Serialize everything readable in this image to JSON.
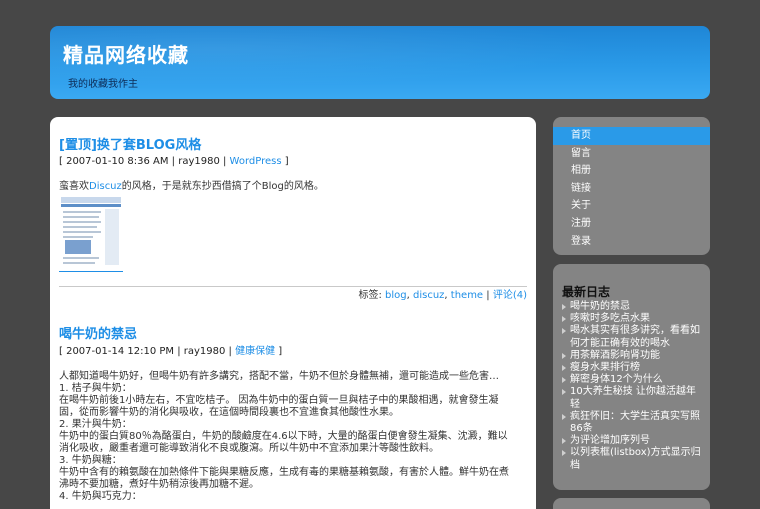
{
  "header": {
    "title": "精品网络收藏",
    "tagline": "我的收藏我作主"
  },
  "posts": [
    {
      "title": "[置顶]换了套BLOG风格",
      "meta_prefix": "[ 2007-01-10 8:36 AM | ray1980 | ",
      "meta_link": "WordPress",
      "meta_suffix": " ]",
      "body_prefix": "蛮喜欢",
      "body_link": "Discuz",
      "body_suffix": "的风格，于是就东抄西借搞了个Blog的风格。",
      "tags_label": "标签:",
      "tags": [
        "blog",
        "discuz",
        "theme"
      ],
      "comments": "评论(4)"
    },
    {
      "title": "喝牛奶的禁忌",
      "meta_prefix": "[ 2007-01-14 12:10 PM | ray1980 | ",
      "meta_link": "健康保健",
      "meta_suffix": " ]",
      "body_lines": [
        "人都知道喝牛奶好，但喝牛奶有許多講究，搭配不當，牛奶不但於身體無補，還可能造成一些危害…",
        "1. 桔子與牛奶：",
        "在喝牛奶前後1小時左右，不宜吃桔子。 因為牛奶中的蛋白質一旦與桔子中的果酸相遇，就會發生凝",
        "固，從而影響牛奶的消化與吸收，在這個時間段裏也不宜進食其他酸性水果。",
        "2. 果汁與牛奶：",
        "牛奶中的蛋白質80％為酪蛋白，牛奶的酸鹼度在4.6以下時，大量的酪蛋白便會發生凝集、沈澱，難以",
        "消化吸收，嚴重者還可能導致消化不良或腹瀉。所以牛奶中不宜添加果汁等酸性飲料。",
        "3. 牛奶與糖：",
        "牛奶中含有的賴氨酸在加熱條件下能與果糖反應，生成有毒的果糖基賴氨酸，有害於人體。鮮牛奶在煮",
        "沸時不要加糖，煮好牛奶稍涼後再加糖不遲。",
        "4. 牛奶與巧克力："
      ]
    }
  ],
  "nav": {
    "items": [
      "首页",
      "留言",
      "相册",
      "链接",
      "关于",
      "注册",
      "登录"
    ],
    "active_index": 0
  },
  "recent": {
    "heading": "最新日志",
    "items": [
      "喝牛奶的禁忌",
      "咳嗽时多吃点水果",
      "喝水其实有很多讲究，看看如何才能正确有效的喝水",
      "用茶解酒影响肾功能",
      "瘦身水果排行榜",
      "解密身体12个为什么",
      "10大养生秘技 让你越活越年轻",
      "疯狂怀旧：大学生活真实写照86条",
      "为评论增加序列号",
      "以列表框(listbox)方式显示归档"
    ]
  },
  "colors": {
    "background": "#474747",
    "accent": "#2a9ae8",
    "link": "#1e8ee6",
    "sidebar": "#848484"
  }
}
